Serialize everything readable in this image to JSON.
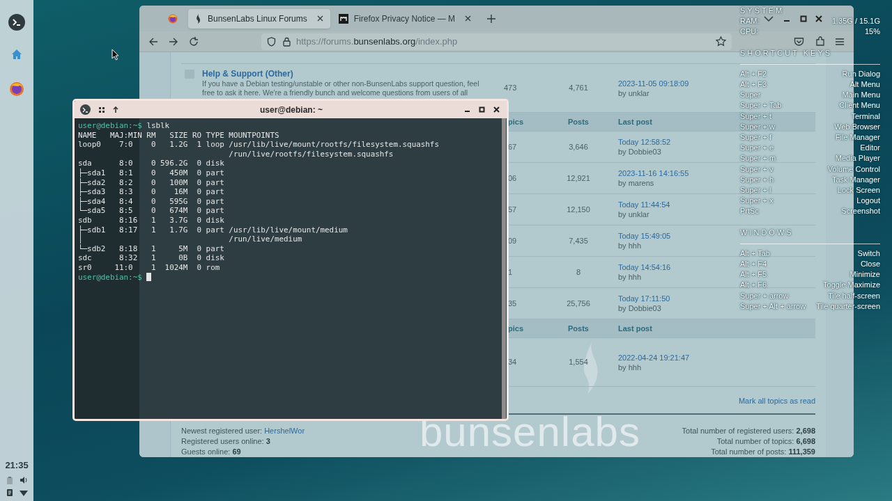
{
  "panel": {
    "clock": "21:35"
  },
  "browser": {
    "tabs": [
      {
        "label": "BunsenLabs Linux Forums",
        "selected": true
      },
      {
        "label": "Firefox Privacy Notice — M",
        "selected": false
      }
    ],
    "url": "https://forums.**bunsenlabs.org**/index.php",
    "forum": {
      "top_forum": {
        "title": "Help & Support (Other)",
        "description": "If you have a Debian testing/unstable or other non-BunsenLabs support question, feel\nfree to ask it here. We're a friendly bunch and welcome questions from users of all",
        "topics": "473",
        "posts": "4,761",
        "time": "2023-11-05 09:18:09",
        "by": "by unklar"
      },
      "sections": [
        {
          "header": {
            "topics": "pics",
            "posts": "Posts",
            "last_post": "Last post"
          },
          "rows": [
            {
              "topics": "67",
              "posts": "3,646",
              "time": "Today 12:58:52",
              "by": "by Dobbie03"
            },
            {
              "topics": "06",
              "posts": "12,921",
              "time": "2023-11-16 14:16:55",
              "by": "by marens"
            },
            {
              "topics": "57",
              "posts": "12,150",
              "time": "Today 11:44:54",
              "by": "by unklar"
            },
            {
              "topics": "09",
              "posts": "7,435",
              "time": "Today 15:49:05",
              "by": "by hhh"
            },
            {
              "topics": "1",
              "posts": "8",
              "time": "Today 14:54:16",
              "by": "by hhh"
            },
            {
              "topics": "35",
              "posts": "25,756",
              "time": "Today 17:11:50",
              "by": "by Dobbie03"
            }
          ]
        },
        {
          "header": {
            "topics": "pics",
            "posts": "Posts",
            "last_post": "Last post"
          },
          "rows": [
            {
              "topics": "34",
              "posts": "1,554",
              "time": "2022-04-24 19:21:47",
              "by": "by hhh"
            }
          ]
        }
      ],
      "mark_all": "Mark all topics as read",
      "stats_left": [
        {
          "kind": "link",
          "text": "Newest registered user:",
          "link": "HershelWor"
        },
        {
          "kind": "text",
          "text": "Registered users online: **3**"
        },
        {
          "kind": "text",
          "text": "Guests online: **69**"
        }
      ],
      "stats_right": [
        "Total number of registered users: **2,698**",
        "Total number of topics: **6,698**",
        "Total number of posts: **111,359**"
      ],
      "wallpaper_logo": "bunsenlabs"
    }
  },
  "terminal": {
    "title": "user@debian: ~",
    "lines": [
      {
        "kind": "prompt",
        "prompt": "user@debian:~$",
        "command": "lsblk",
        "cursor": false
      },
      {
        "kind": "output",
        "text": "NAME   MAJ:MIN RM   SIZE RO TYPE MOUNTPOINTS"
      },
      {
        "kind": "output",
        "text": "loop0    7:0    0   1.2G  1 loop /usr/lib/live/mount/rootfs/filesystem.squashfs"
      },
      {
        "kind": "output",
        "text": "                                 /run/live/rootfs/filesystem.squashfs"
      },
      {
        "kind": "output",
        "text": "sda      8:0    0 596.2G  0 disk"
      },
      {
        "kind": "output",
        "text": "├─sda1   8:1    0   450M  0 part"
      },
      {
        "kind": "output",
        "text": "├─sda2   8:2    0   100M  0 part"
      },
      {
        "kind": "output",
        "text": "├─sda3   8:3    0    16M  0 part"
      },
      {
        "kind": "output",
        "text": "├─sda4   8:4    0   595G  0 part"
      },
      {
        "kind": "output",
        "text": "└─sda5   8:5    0   674M  0 part"
      },
      {
        "kind": "output",
        "text": "sdb      8:16   1   3.7G  0 disk"
      },
      {
        "kind": "output",
        "text": "├─sdb1   8:17   1   1.7G  0 part /usr/lib/live/mount/medium"
      },
      {
        "kind": "output",
        "text": "│                                /run/live/medium"
      },
      {
        "kind": "output",
        "text": "└─sdb2   8:18   1     5M  0 part"
      },
      {
        "kind": "output",
        "text": "sdc      8:32   1     0B  0 disk"
      },
      {
        "kind": "output",
        "text": "sr0     11:0    1  1024M  0 rom"
      },
      {
        "kind": "prompt",
        "prompt": "user@debian:~$",
        "cursor": true
      }
    ]
  },
  "conky": {
    "system": {
      "title": "SYSTEM",
      "rows": [
        {
          "label": "RAM:",
          "value": "1.35G / 15.1G"
        },
        {
          "label": "CPU:",
          "value": "15%"
        }
      ]
    },
    "sections": [
      {
        "title": "SHORTCUT KEYS",
        "rows": [
          {
            "keys": "Alt + F2",
            "action": "Run Dialog"
          },
          {
            "keys": "Alt + F3",
            "action": "Alt Menu"
          },
          {
            "keys": "Super",
            "action": "Main Menu"
          },
          {
            "keys": "Super + Tab",
            "action": "Client Menu"
          },
          {
            "keys": "Super + t",
            "action": "Terminal"
          },
          {
            "keys": "Super + w",
            "action": "Web Browser"
          },
          {
            "keys": "Super + f",
            "action": "File Manager"
          },
          {
            "keys": "Super + e",
            "action": "Editor"
          },
          {
            "keys": "Super + m",
            "action": "Media Player"
          },
          {
            "keys": "Super + v",
            "action": "Volume Control"
          },
          {
            "keys": "Super + h",
            "action": "Task Manager"
          },
          {
            "keys": "Super + l",
            "action": "Lock Screen"
          },
          {
            "keys": "Super + x",
            "action": "Logout"
          },
          {
            "keys": "PrtSc",
            "action": "Screenshot"
          }
        ]
      },
      {
        "title": "WINDOWS",
        "rows": [
          {
            "keys": "Alt + Tab",
            "action": "Switch"
          },
          {
            "keys": "Alt + F4",
            "action": "Close"
          },
          {
            "keys": "Alt + F5",
            "action": "Minimize"
          },
          {
            "keys": "Alt + F6",
            "action": "Toggle Maximize"
          },
          {
            "keys": "Super + arrow",
            "action": "Tile half-screen"
          },
          {
            "keys": "Super + Alt + arrow",
            "action": "Tile quarter-screen"
          }
        ]
      }
    ]
  }
}
